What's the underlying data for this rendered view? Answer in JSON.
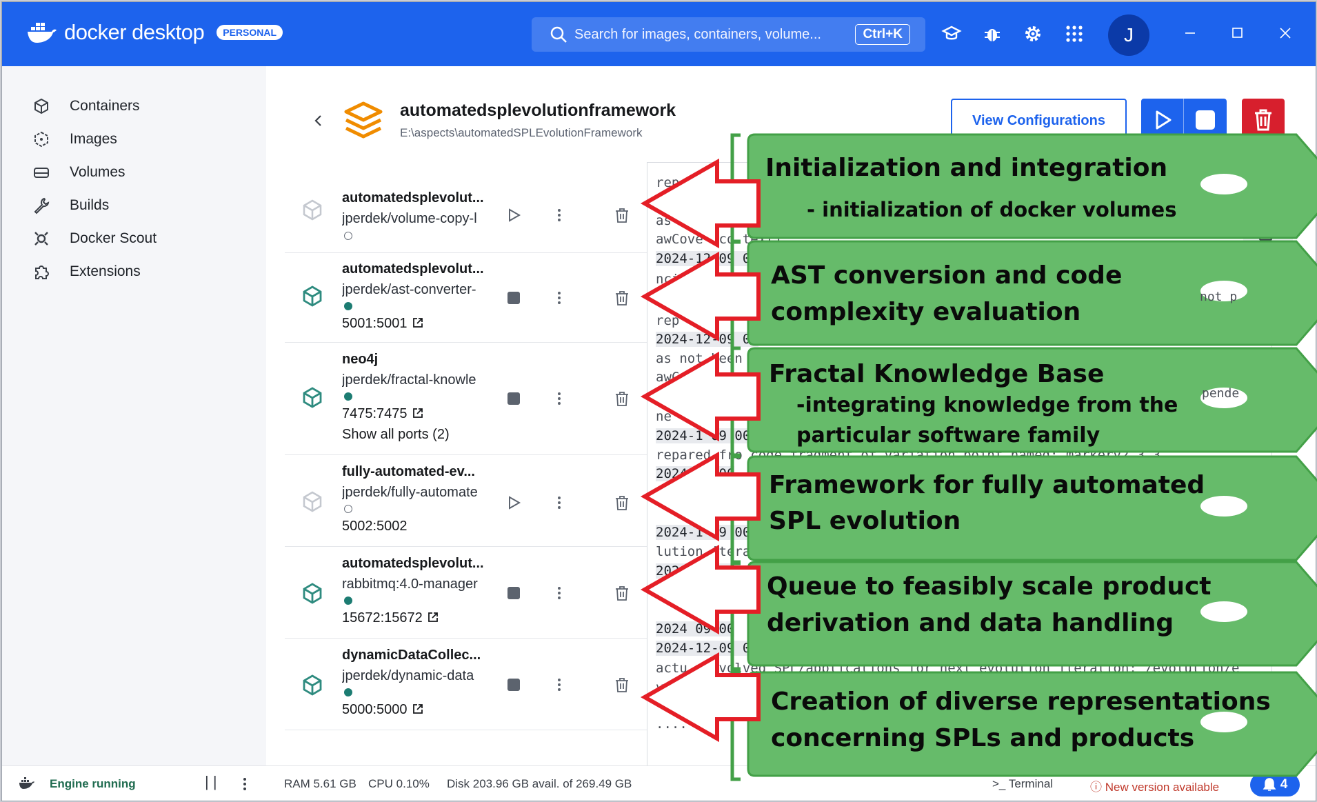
{
  "app": {
    "brand": "docker desktop",
    "plan_badge": "PERSONAL",
    "accent": "#1d63ed"
  },
  "search": {
    "placeholder": "Search for images, containers, volume...",
    "shortcut": "Ctrl+K"
  },
  "user": {
    "initial": "J"
  },
  "sidebar": {
    "items": [
      {
        "label": "Containers",
        "icon": "container-icon"
      },
      {
        "label": "Images",
        "icon": "images-icon"
      },
      {
        "label": "Volumes",
        "icon": "volumes-icon"
      },
      {
        "label": "Builds",
        "icon": "wrench-icon"
      },
      {
        "label": "Docker Scout",
        "icon": "scout-icon"
      },
      {
        "label": "Extensions",
        "icon": "puzzle-icon"
      }
    ]
  },
  "header": {
    "title": "automatedsplevolutionframework",
    "path": "E:\\aspects\\automatedSPLEvolutionFramework",
    "view_config": "View Configurations"
  },
  "containers": [
    {
      "name": "automatedsplevolut...",
      "image": "jperdek/volume-copy-l",
      "state": "stopped",
      "port": "",
      "extra": ""
    },
    {
      "name": "automatedsplevolut...",
      "image": "jperdek/ast-converter-",
      "state": "running",
      "port": "5001:5001",
      "extra": ""
    },
    {
      "name": "neo4j",
      "image": "jperdek/fractal-knowle",
      "state": "running",
      "port": "7475:7475",
      "extra": "Show all ports (2)"
    },
    {
      "name": "fully-automated-ev...",
      "image": "jperdek/fully-automate",
      "state": "stopped",
      "port": "5002:5002",
      "extra": ""
    },
    {
      "name": "automatedsplevolut...",
      "image": "rabbitmq:4.0-manager",
      "state": "running",
      "port": "15672:15672",
      "extra": ""
    },
    {
      "name": "dynamicDataCollec...",
      "image": "jperdek/dynamic-data",
      "state": "running",
      "port": "5000:5000",
      "extra": ""
    }
  ],
  "logs": [
    "rep",
    "as",
    "awCove (co text)",
    "2024-12-09 00",
    "nci",
    "rep",
    "2024-12-09 00",
    "as not been a",
    "awCo",
    "2024-1 09 00",
    "ne",
    "2024-1 09 00",
    "repared fro code fragment of variation point named: markerv2_3_3",
    "2024 09 00",
    "2024-1 09 00",
    "lution itera",
    "2024 09 00",
    "2024 09 00",
    "2024-12-09 00",
    " actu y evolved SPL/applications for next evolution iteration: /evolution/e",
    "vo",
    "...."
  ],
  "log_fragments": {
    "not_p": "not p",
    "pende": "pende"
  },
  "statusbar": {
    "engine": "Engine running",
    "ram": "RAM 5.61 GB",
    "cpu": "CPU 0.10%",
    "disk": "Disk 203.96 GB avail. of 269.49 GB",
    "terminal": "Terminal",
    "update": "New version available",
    "notifications": "4"
  },
  "annotations": [
    {
      "title": "Initialization and integration",
      "subtitle": "- initialization of docker volumes"
    },
    {
      "title": "AST conversion and code",
      "subtitle": "complexity evaluation"
    },
    {
      "title": "Fractal Knowledge Base",
      "subtitle": "-integrating knowledge from the",
      "subtitle2": "particular software family"
    },
    {
      "title": "Framework for fully automated",
      "subtitle": "SPL evolution"
    },
    {
      "title": "Queue to feasibly scale product",
      "subtitle": "derivation and data handling"
    },
    {
      "title": "Creation of diverse representations",
      "subtitle": "concerning SPLs and products"
    }
  ],
  "annotation_colors": {
    "tag_fill": "#66bb6a",
    "tag_stroke": "#43a047",
    "arrow": "#e41e26"
  }
}
